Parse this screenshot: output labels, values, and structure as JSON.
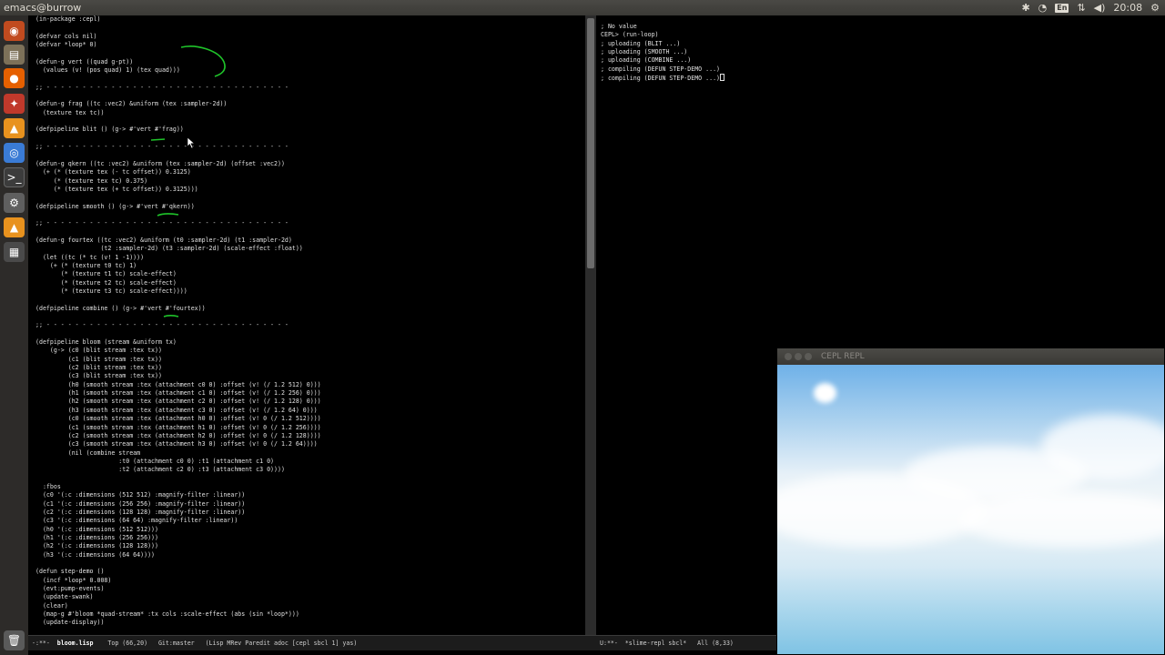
{
  "topbar": {
    "window_title": "emacs@burrow",
    "lang": "En",
    "time": "20:08",
    "tray_icons": [
      "bluetooth-icon",
      "wifi-icon",
      "keyboard-language-icon",
      "network-icon",
      "volume-icon",
      "clock",
      "settings-gear-icon"
    ]
  },
  "launcher": {
    "items": [
      {
        "name": "ubuntu-dash-icon",
        "color": "#c14b1f"
      },
      {
        "name": "files-icon",
        "color": "#8a7a5a"
      },
      {
        "name": "firefox-icon",
        "color": "#e66000"
      },
      {
        "name": "settings-icon",
        "color": "#c0392b"
      },
      {
        "name": "vlc-icon",
        "color": "#e8921e"
      },
      {
        "name": "chromium-icon",
        "color": "#3a7bd5"
      },
      {
        "name": "terminal-icon",
        "color": "#3c3c3c"
      },
      {
        "name": "gear-icon",
        "color": "#6a6a6a"
      },
      {
        "name": "vlc-cone-icon",
        "color": "#e8921e"
      },
      {
        "name": "workspace-icon",
        "color": "#4a4a4a"
      },
      {
        "name": "trash-icon",
        "color": "#5a5a5a"
      }
    ]
  },
  "editor": {
    "lines": [
      "(in-package :cepl)",
      "",
      "(defvar cols nil)",
      "(defvar *loop* 0)",
      "",
      "(defun-g vert ((quad g-pt))",
      "  (values (v! (pos quad) 1) (tex quad)))",
      "",
      ";; - - - - - - - - - - - - - - - - - - - - - - - - - - - - - - - - - -",
      "",
      "(defun-g frag ((tc :vec2) &uniform (tex :sampler-2d))",
      "  (texture tex tc))",
      "",
      "(defpipeline blit () (g-> #'vert #'frag))",
      "",
      ";; - - - - - - - - - - - - - - - - - - - - - - - - - - - - - - - - - -",
      "",
      "(defun-g qkern ((tc :vec2) &uniform (tex :sampler-2d) (offset :vec2))",
      "  (+ (* (texture tex (- tc offset)) 0.3125)",
      "     (* (texture tex tc) 0.375)",
      "     (* (texture tex (+ tc offset)) 0.3125)))",
      "",
      "(defpipeline smooth () (g-> #'vert #'qkern))",
      "",
      ";; - - - - - - - - - - - - - - - - - - - - - - - - - - - - - - - - - -",
      "",
      "(defun-g fourtex ((tc :vec2) &uniform (t0 :sampler-2d) (t1 :sampler-2d)",
      "                  (t2 :sampler-2d) (t3 :sampler-2d) (scale-effect :float))",
      "  (let ((tc (* tc (v! 1 -1))))",
      "    (+ (* (texture t0 tc) 1)",
      "       (* (texture t1 tc) scale-effect)",
      "       (* (texture t2 tc) scale-effect)",
      "       (* (texture t3 tc) scale-effect))))",
      "",
      "(defpipeline combine () (g-> #'vert #'fourtex))",
      "",
      ";; - - - - - - - - - - - - - - - - - - - - - - - - - - - - - - - - - -",
      "",
      "(defpipeline bloom (stream &uniform tx)",
      "    (g-> (c0 (blit stream :tex tx))",
      "         (c1 (blit stream :tex tx))",
      "         (c2 (blit stream :tex tx))",
      "         (c3 (blit stream :tex tx))",
      "         (h0 (smooth stream :tex (attachment c0 0) :offset (v! (/ 1.2 512) 0)))",
      "         (h1 (smooth stream :tex (attachment c1 0) :offset (v! (/ 1.2 256) 0)))",
      "         (h2 (smooth stream :tex (attachment c2 0) :offset (v! (/ 1.2 128) 0)))",
      "         (h3 (smooth stream :tex (attachment c3 0) :offset (v! (/ 1.2 64) 0)))",
      "         (c0 (smooth stream :tex (attachment h0 0) :offset (v! 0 (/ 1.2 512))))",
      "         (c1 (smooth stream :tex (attachment h1 0) :offset (v! 0 (/ 1.2 256))))",
      "         (c2 (smooth stream :tex (attachment h2 0) :offset (v! 0 (/ 1.2 128))))",
      "         (c3 (smooth stream :tex (attachment h3 0) :offset (v! 0 (/ 1.2 64))))",
      "         (nil (combine stream",
      "                       :t0 (attachment c0 0) :t1 (attachment c1 0)",
      "                       :t2 (attachment c2 0) :t3 (attachment c3 0))))",
      "",
      "  :fbos",
      "  (c0 '(:c :dimensions (512 512) :magnify-filter :linear))",
      "  (c1 '(:c :dimensions (256 256) :magnify-filter :linear))",
      "  (c2 '(:c :dimensions (128 128) :magnify-filter :linear))",
      "  (c3 '(:c :dimensions (64 64) :magnify-filter :linear))",
      "  (h0 '(:c :dimensions (512 512)))",
      "  (h1 '(:c :dimensions (256 256)))",
      "  (h2 '(:c :dimensions (128 128)))",
      "  (h3 '(:c :dimensions (64 64))))",
      "",
      "(defun step-demo ()",
      "  (incf *loop* 0.008)",
      "  (evt:pump-events)",
      "  (update-swank)",
      "  (clear)",
      "  (map-g #'bloom *quad-stream* :tx cols :scale-effect (abs (sin *loop*)))",
      "  (update-display))",
      "",
      ";;--------------------------------------------------------------------"
    ]
  },
  "repl_buffer": {
    "lines": [
      "; No value",
      "CEPL> (run-loop)",
      "; uploading (BLIT ...)",
      "; uploading (SMOOTH ...)",
      "; uploading (COMBINE ...)",
      "; compiling (DEFUN STEP-DEMO ...)",
      "; compiling (DEFUN STEP-DEMO ...)"
    ]
  },
  "modeline_left": {
    "prefix": "-:**-  ",
    "filename": "bloom.lisp",
    "rest": "    Top (66,20)   Git:master   (Lisp MRev Paredit adoc [cepl sbcl 1] yas)"
  },
  "modeline_right": {
    "text": "U:**-  *slime-repl sbcl*   All (8,33)"
  },
  "repl_window": {
    "title": "CEPL REPL"
  }
}
